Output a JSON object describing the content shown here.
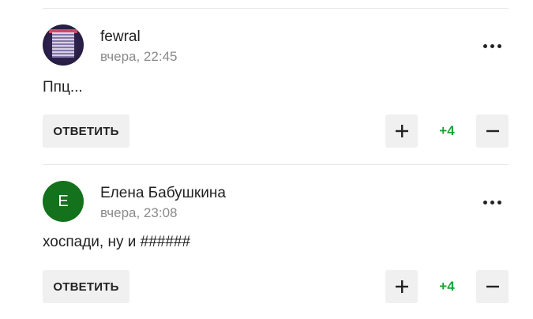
{
  "colors": {
    "score_positive": "#1aa33a",
    "avatar_letter_bg": "#14721c"
  },
  "comments": [
    {
      "author": "fewral",
      "timestamp": "вчера, 22:45",
      "text": "Ппц...",
      "avatar": {
        "type": "image"
      },
      "reply_label": "ОТВЕТИТЬ",
      "score": "+4",
      "upvote_icon": "plus-icon",
      "downvote_icon": "minus-icon",
      "more_icon": "more-dots-icon"
    },
    {
      "author": "Елена Бабушкина",
      "timestamp": "вчера, 23:08",
      "text": "хоспади, ну и ######",
      "avatar": {
        "type": "letter",
        "letter": "Е"
      },
      "reply_label": "ОТВЕТИТЬ",
      "score": "+4",
      "upvote_icon": "plus-icon",
      "downvote_icon": "minus-icon",
      "more_icon": "more-dots-icon"
    }
  ]
}
